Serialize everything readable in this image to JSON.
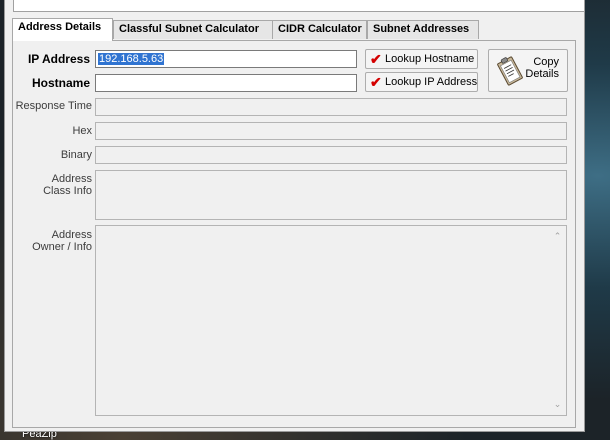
{
  "tabs": [
    {
      "label": "Address Details",
      "active": true
    },
    {
      "label": "Classful Subnet Calculator",
      "active": false
    },
    {
      "label": "CIDR Calculator",
      "active": false
    },
    {
      "label": "Subnet Addresses",
      "active": false
    }
  ],
  "form": {
    "ip_address_label": "IP Address",
    "ip_address_value": "192.168.5.63",
    "hostname_label": "Hostname",
    "hostname_value": "",
    "lookup_hostname_label": "Lookup Hostname",
    "lookup_ip_label": "Lookup IP Address",
    "copy_details_line1": "Copy",
    "copy_details_line2": "Details",
    "response_time_label": "Response Time",
    "hex_label": "Hex",
    "binary_label": "Binary",
    "address_class_label_1": "Address",
    "address_class_label_2": "Class Info",
    "address_owner_label_1": "Address",
    "address_owner_label_2": "Owner / Info"
  },
  "desktop": {
    "taskbar_item": "PeaZip"
  },
  "colors": {
    "selection": "#3074d1",
    "check_mark": "#d40000",
    "window_bg": "#f0f0f0"
  },
  "icons": {
    "check": "check-mark-icon",
    "clipboard": "clipboard-icon",
    "scroll_up": "scroll-up-arrow-icon",
    "scroll_down": "scroll-down-arrow-icon"
  }
}
